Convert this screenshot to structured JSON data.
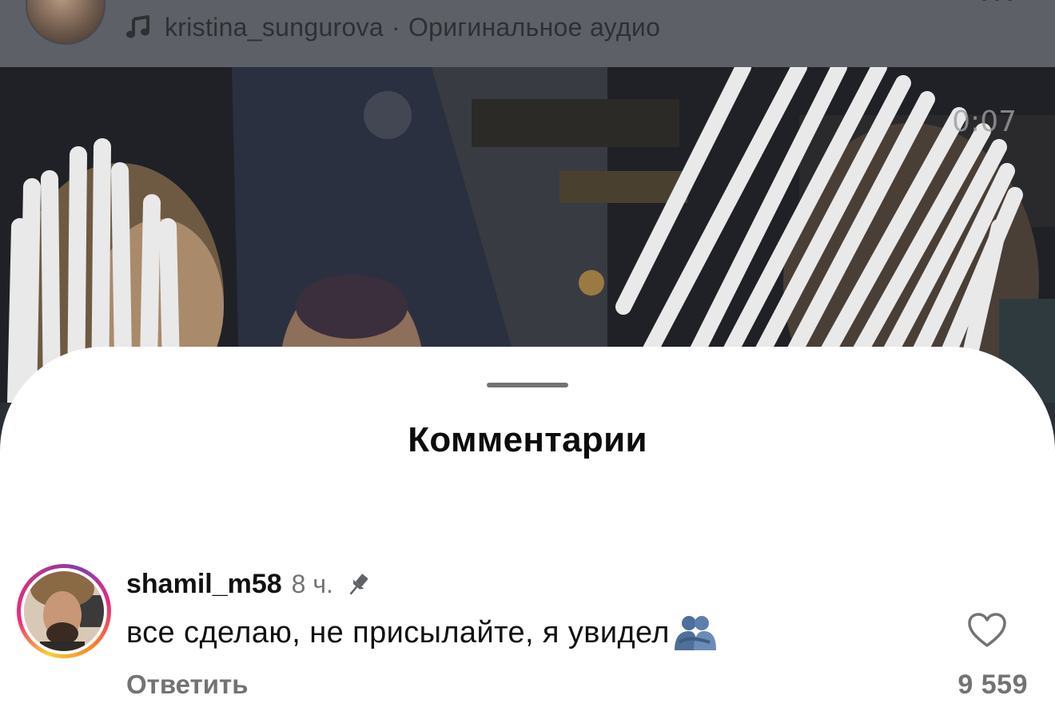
{
  "header": {
    "audio_author": "kristina_sungurova",
    "audio_separator": "·",
    "audio_title": "Оригинальное аудио",
    "icons": [
      "music-note-icon",
      "more-options-icon"
    ]
  },
  "video": {
    "timer": "0:07"
  },
  "comments_sheet": {
    "title": "Комментарии",
    "comments": [
      {
        "username": "shamil_m58",
        "time": "8 ч.",
        "pinned": true,
        "text": "все сделаю, не присылайте, я увидел",
        "emoji": "hugging-people-emoji",
        "reply_label": "Ответить",
        "like_count": "9 559"
      }
    ]
  },
  "colors": {
    "sheet_background": "#ffffff",
    "header_dim": "#5d6066",
    "secondary_text": "#737373",
    "story_ring": [
      "#f9ce34",
      "#ee2a7b",
      "#833ab4"
    ]
  }
}
